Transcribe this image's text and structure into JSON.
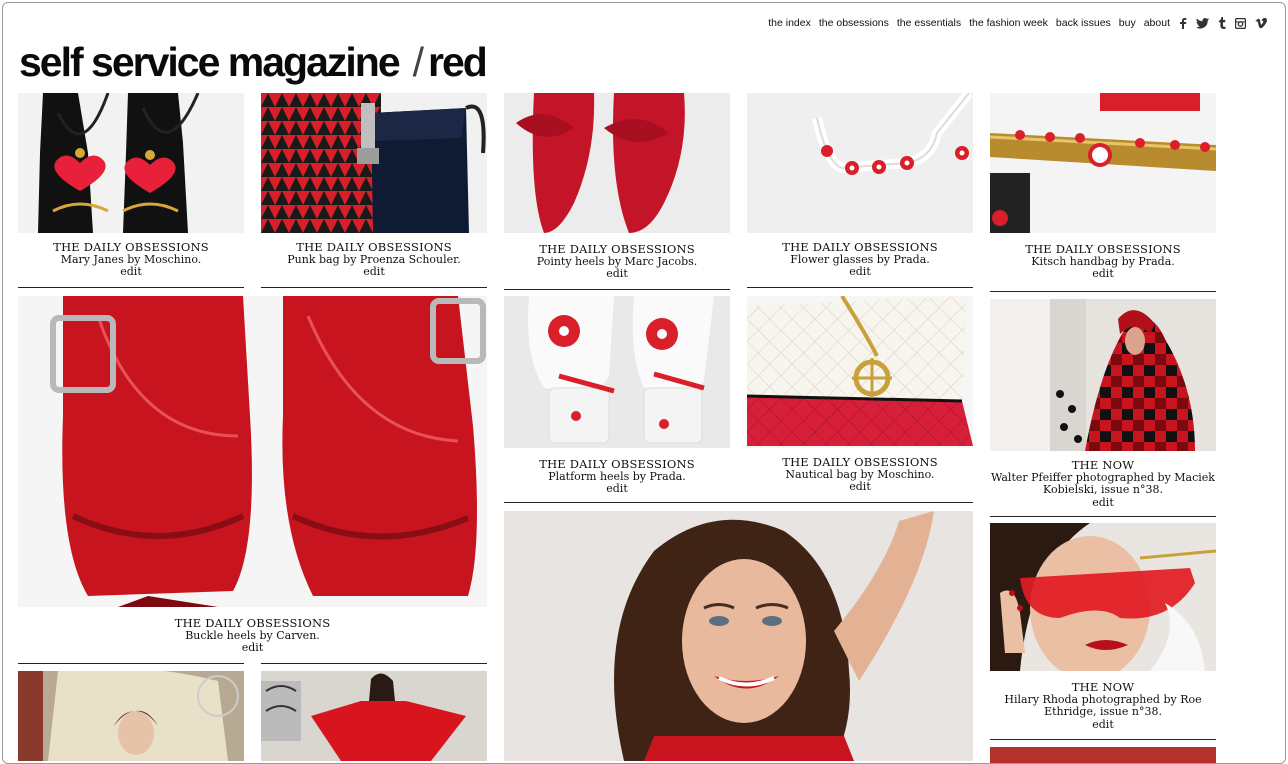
{
  "nav": {
    "links": [
      "the index",
      "the obsessions",
      "the essentials",
      "the fashion week",
      "back issues",
      "buy",
      "about"
    ],
    "social": [
      "facebook-icon",
      "twitter-icon",
      "tumblr-icon",
      "instagram-icon",
      "vimeo-icon"
    ]
  },
  "logo": {
    "name": "self service magazine",
    "section": "red"
  },
  "edit_label": "edit",
  "tiles": {
    "t1": {
      "kicker": "THE DAILY OBSESSIONS",
      "text": "Mary Janes by Moschino.",
      "edit": "edit"
    },
    "t2": {
      "kicker": "THE DAILY OBSESSIONS",
      "text": "Punk bag by Proenza Schouler.",
      "edit": "edit"
    },
    "t3": {
      "kicker": "THE DAILY OBSESSIONS",
      "text": "Pointy heels by Marc Jacobs.",
      "edit": "edit"
    },
    "t4": {
      "kicker": "THE DAILY OBSESSIONS",
      "text": "Flower glasses by Prada.",
      "edit": "edit"
    },
    "t5": {
      "kicker": "THE DAILY OBSESSIONS",
      "text": "Kitsch handbag by Prada.",
      "edit": "edit"
    },
    "t6": {
      "kicker": "THE DAILY OBSESSIONS",
      "text": "Buckle heels by Carven.",
      "edit": "edit"
    },
    "t7": {
      "kicker": "THE DAILY OBSESSIONS",
      "text": "Platform heels by Prada.",
      "edit": "edit"
    },
    "t8": {
      "kicker": "THE DAILY OBSESSIONS",
      "text": "Nautical bag by Moschino.",
      "edit": "edit"
    },
    "t9": {
      "kicker": "THE NOW",
      "text": "Walter Pfeiffer photographed by Maciek Kobielski, issue n°38.",
      "edit": "edit"
    },
    "t10": {
      "kicker": "THE NOW",
      "text": "Hilary Rhoda photographed by Roe Ethridge, issue n°38.",
      "edit": "edit"
    }
  },
  "colors": {
    "accent": "#c8141e",
    "text": "#111111",
    "rule": "#222222"
  }
}
